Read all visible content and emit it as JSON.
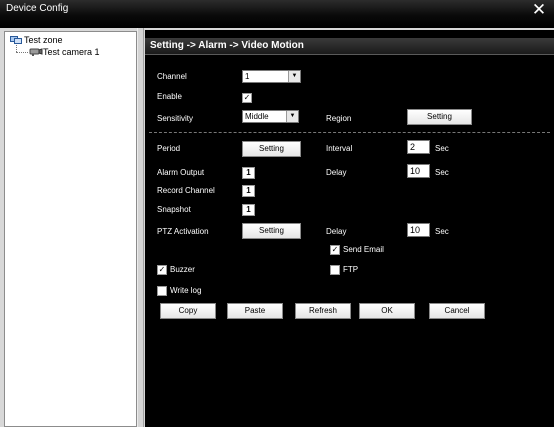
{
  "window": {
    "title": "Device Config",
    "close_glyph": "✕"
  },
  "tree": {
    "zone_label": "Test zone",
    "camera_label": "Test camera 1"
  },
  "panel": {
    "breadcrumb": "Setting -> Alarm -> Video Motion",
    "channel": {
      "label": "Channel",
      "value": "1"
    },
    "enable": {
      "label": "Enable",
      "checked": true
    },
    "sensitivity": {
      "label": "Sensitivity",
      "value": "Middle"
    },
    "region": {
      "label": "Region",
      "button": "Setting"
    },
    "period": {
      "label": "Period",
      "button": "Setting"
    },
    "interval": {
      "label": "Interval",
      "value": "2",
      "unit": "Sec"
    },
    "alarm_output": {
      "label": "Alarm Output",
      "value": "1"
    },
    "delay1": {
      "label": "Delay",
      "value": "10",
      "unit": "Sec"
    },
    "record_channel": {
      "label": "Record Channel",
      "value": "1"
    },
    "snapshot": {
      "label": "Snapshot",
      "value": "1"
    },
    "ptz": {
      "label": "PTZ Activation",
      "button": "Setting"
    },
    "delay2": {
      "label": "Delay",
      "value": "10",
      "unit": "Sec"
    },
    "send_email": {
      "label": "Send Email",
      "checked": true
    },
    "buzzer": {
      "label": "Buzzer",
      "checked": true
    },
    "ftp": {
      "label": "FTP",
      "checked": false
    },
    "write_log": {
      "label": "Write log",
      "checked": false
    },
    "buttons": {
      "copy": "Copy",
      "paste": "Paste",
      "refresh": "Refresh",
      "ok": "OK",
      "cancel": "Cancel"
    }
  }
}
